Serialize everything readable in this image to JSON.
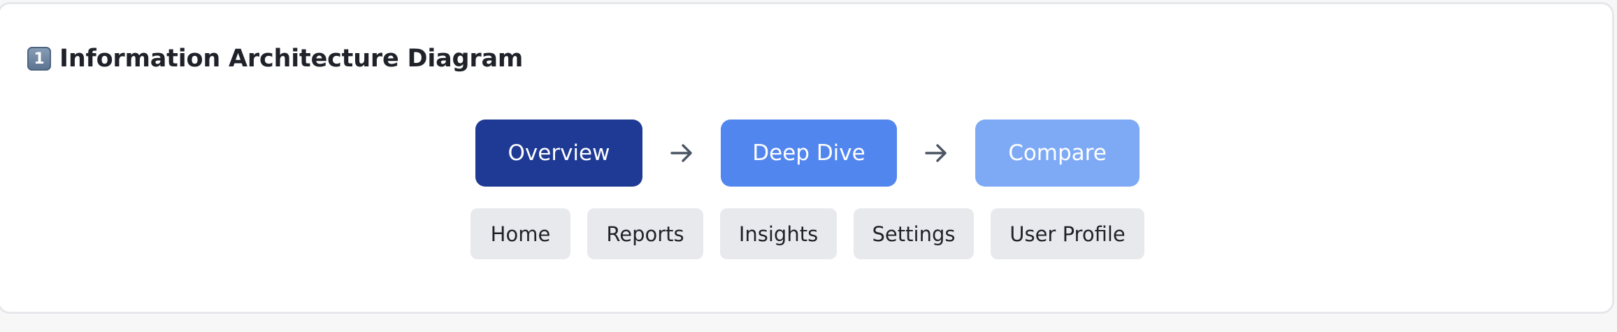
{
  "section": {
    "number_badge": "1",
    "title": "Information Architecture Diagram"
  },
  "flow": {
    "steps": [
      {
        "label": "Overview",
        "color": "#1e3a94"
      },
      {
        "label": "Deep Dive",
        "color": "#5286ef"
      },
      {
        "label": "Compare",
        "color": "#7eaaf5"
      }
    ],
    "connector_icon": "arrow-right-icon"
  },
  "nav": {
    "items": [
      {
        "label": "Home"
      },
      {
        "label": "Reports"
      },
      {
        "label": "Insights"
      },
      {
        "label": "Settings"
      },
      {
        "label": "User Profile"
      }
    ]
  },
  "colors": {
    "card_background": "#ffffff",
    "page_background": "#f7f7f8",
    "nav_item_background": "#e8e9ec",
    "text": "#1f2229",
    "arrow": "#4b5563"
  }
}
